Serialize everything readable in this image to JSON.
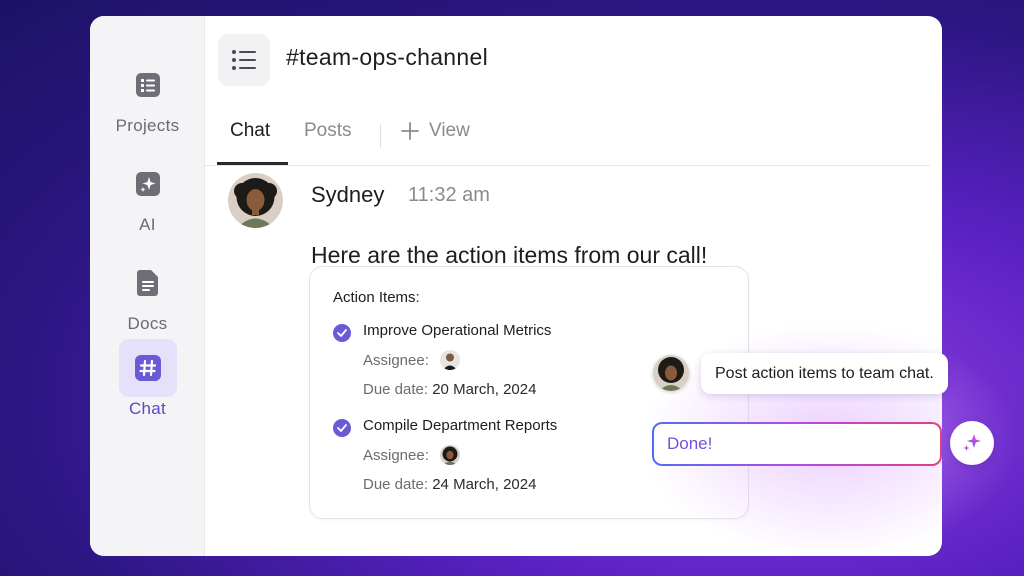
{
  "sidebar": {
    "items": [
      {
        "label": "Projects",
        "icon": "list-icon"
      },
      {
        "label": "AI",
        "icon": "sparkle-icon"
      },
      {
        "label": "Docs",
        "icon": "document-icon"
      },
      {
        "label": "Chat",
        "icon": "hash-icon",
        "active": true
      }
    ]
  },
  "header": {
    "channel": "#team-ops-channel"
  },
  "tabs": [
    {
      "label": "Chat",
      "active": true
    },
    {
      "label": "Posts"
    },
    {
      "label": "View",
      "icon": "plus-icon"
    }
  ],
  "message": {
    "sender": "Sydney",
    "time": "11:32 am",
    "text": "Here are the action items from our call!"
  },
  "card": {
    "title": "Action Items:",
    "items": [
      {
        "title": "Improve Operational Metrics",
        "assignee_label": "Assignee:",
        "due_label": "Due date:",
        "due_value": "20 March, 2024"
      },
      {
        "title": "Compile Department Reports",
        "assignee_label": "Assignee:",
        "due_label": "Due date:",
        "due_value": "24 March, 2024"
      }
    ]
  },
  "ai": {
    "prompt": "Post action items to team chat.",
    "reply": "Done!"
  },
  "colors": {
    "accent": "#5b48c9",
    "check": "#6a5ad6",
    "background_purple": "#5b21c4"
  }
}
